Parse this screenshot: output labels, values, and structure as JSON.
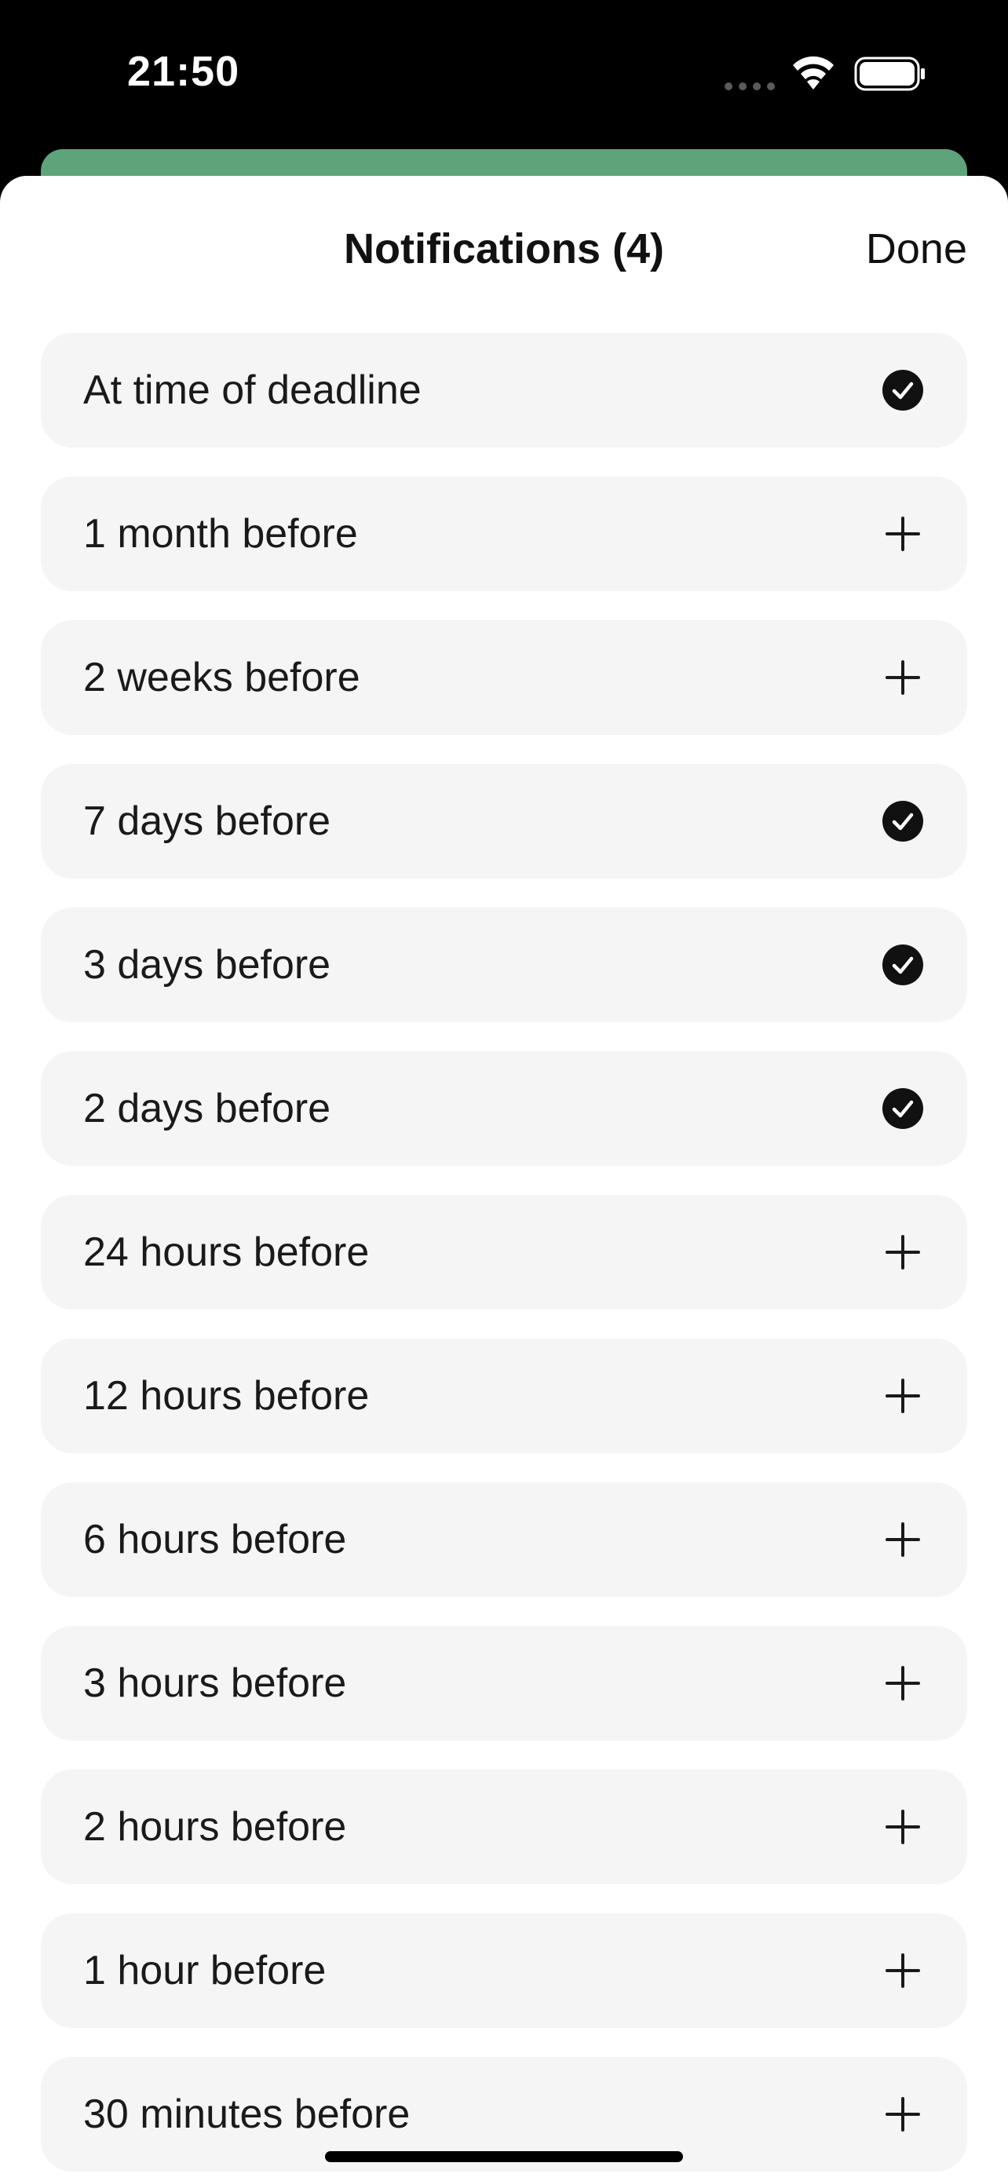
{
  "status_bar": {
    "time": "21:50"
  },
  "sheet": {
    "title": "Notifications (4)",
    "done_label": "Done"
  },
  "options": [
    {
      "label": "At time of deadline",
      "selected": true
    },
    {
      "label": "1 month before",
      "selected": false
    },
    {
      "label": "2 weeks before",
      "selected": false
    },
    {
      "label": "7 days before",
      "selected": true
    },
    {
      "label": "3 days before",
      "selected": true
    },
    {
      "label": "2 days before",
      "selected": true
    },
    {
      "label": "24 hours before",
      "selected": false
    },
    {
      "label": "12 hours before",
      "selected": false
    },
    {
      "label": "6 hours before",
      "selected": false
    },
    {
      "label": "3 hours before",
      "selected": false
    },
    {
      "label": "2 hours before",
      "selected": false
    },
    {
      "label": "1 hour before",
      "selected": false
    },
    {
      "label": "30 minutes before",
      "selected": false
    }
  ],
  "icons": {
    "selected": "checkmark-circle-icon",
    "unselected": "plus-icon"
  },
  "colors": {
    "accent_behind": "#5fa37a",
    "row_background": "#f5f5f5",
    "text": "#1a1a1a"
  }
}
